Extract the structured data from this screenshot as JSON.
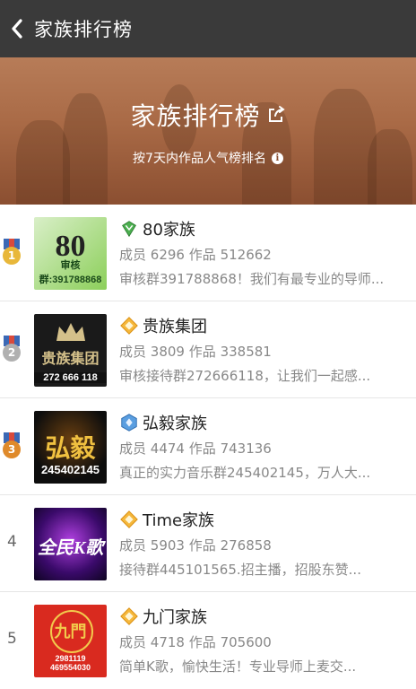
{
  "topbar": {
    "title": "家族排行榜"
  },
  "banner": {
    "heading": "家族排行榜",
    "subtitle": "按7天内作品人气榜排名"
  },
  "families": [
    {
      "rank": "1",
      "name": "80家族",
      "members_label": "成员",
      "members": "6296",
      "works_label": "作品",
      "works": "512662",
      "desc": "审核群391788868！我们有最专业的导师...",
      "thumb_text": "80",
      "thumb_sub": "审核群:391788868",
      "medal": "gold",
      "badge_color": "#4caf50"
    },
    {
      "rank": "2",
      "name": "贵族集团",
      "members_label": "成员",
      "members": "3809",
      "works_label": "作品",
      "works": "338581",
      "desc": "审核接待群272666118，让我们一起感...",
      "thumb_text": "贵族集团",
      "thumb_sub": "272 666 118",
      "medal": "silver",
      "badge_color": "#f0a030"
    },
    {
      "rank": "3",
      "name": "弘毅家族",
      "members_label": "成员",
      "members": "4474",
      "works_label": "作品",
      "works": "743136",
      "desc": "真正的实力音乐群245402145，万人大...",
      "thumb_text": "弘毅",
      "thumb_sub": "245402145",
      "medal": "bronze",
      "badge_color": "#4a90d9"
    },
    {
      "rank": "4",
      "name": "Time家族",
      "members_label": "成员",
      "members": "5903",
      "works_label": "作品",
      "works": "276858",
      "desc": "接待群445101565.招主播，招股东赞...",
      "thumb_text": "全民K歌",
      "thumb_sub": "",
      "medal": "",
      "badge_color": "#f0a030"
    },
    {
      "rank": "5",
      "name": "九门家族",
      "members_label": "成员",
      "members": "4718",
      "works_label": "作品",
      "works": "705600",
      "desc": "简单K歌，愉快生活！专业导师上麦交...",
      "thumb_text": "九門",
      "thumb_sub": "2981119 469554030",
      "medal": "",
      "badge_color": "#f0a030"
    }
  ]
}
